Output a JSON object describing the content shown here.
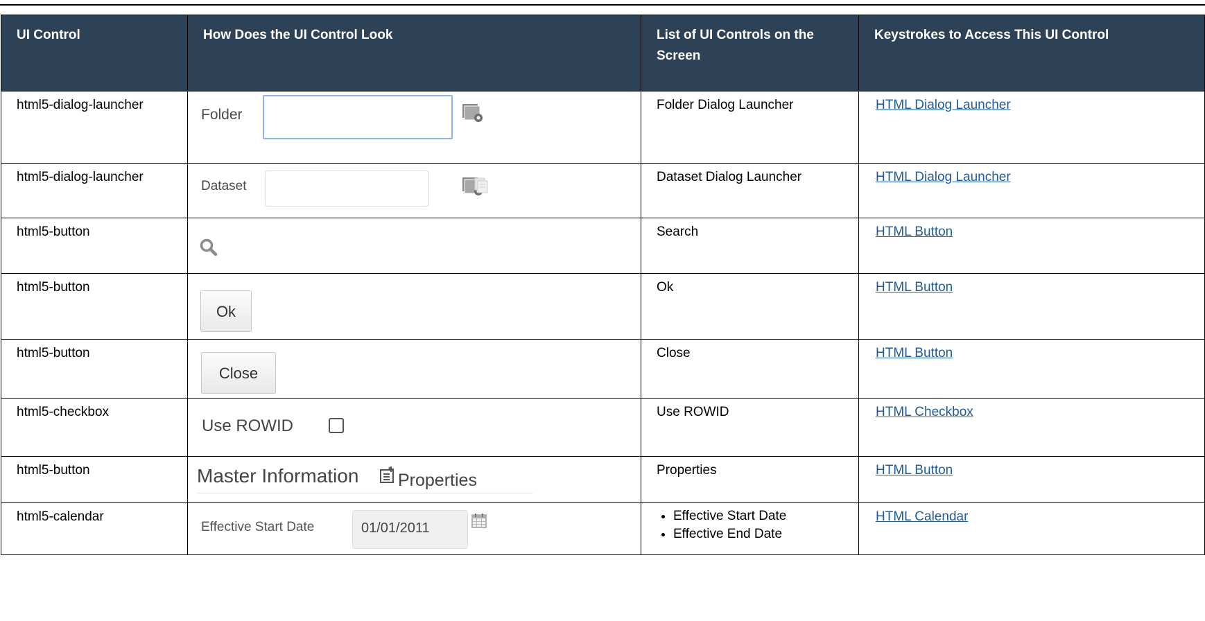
{
  "table": {
    "headers": {
      "ui_control": "UI Control",
      "look": "How Does the UI Control Look",
      "list": "List of UI Controls on the Screen",
      "keys": "Keystrokes to Access This UI Control"
    },
    "rows": [
      {
        "ui_control": "html5-dialog-launcher",
        "list": "Folder Dialog Launcher",
        "link": "HTML Dialog Launcher",
        "look": {
          "label": "Folder",
          "icon": "folder-dialog-icon"
        }
      },
      {
        "ui_control": "html5-dialog-launcher",
        "list": "Dataset Dialog Launcher",
        "link": "HTML Dialog Launcher",
        "look": {
          "label": "Dataset",
          "icons": [
            "folder-dialog-icon",
            "copy-icon"
          ]
        }
      },
      {
        "ui_control": "html5-button",
        "list": "Search",
        "link": "HTML Button",
        "look": {
          "icon": "search-icon"
        }
      },
      {
        "ui_control": "html5-button",
        "list": "Ok",
        "link": "HTML Button",
        "look": {
          "button_label": "Ok"
        }
      },
      {
        "ui_control": "html5-button",
        "list": "Close",
        "link": "HTML Button",
        "look": {
          "button_label": "Close"
        }
      },
      {
        "ui_control": "html5-checkbox",
        "list": "Use ROWID",
        "link": "HTML Checkbox",
        "look": {
          "label": "Use ROWID",
          "checked": false
        }
      },
      {
        "ui_control": "html5-button",
        "list": "Properties",
        "link": "HTML Button",
        "look": {
          "title": "Master Information",
          "button_label": "Properties",
          "icon": "edit-properties-icon"
        }
      },
      {
        "ui_control": "html5-calendar",
        "list_items": [
          "Effective Start Date",
          "Effective End Date"
        ],
        "link": "HTML Calendar",
        "look": {
          "label": "Effective Start Date",
          "value": "01/01/2011",
          "icon": "calendar-icon"
        }
      }
    ]
  },
  "colors": {
    "header_bg": "#2e4257",
    "header_text": "#ffffff",
    "link": "#1f5c99",
    "focus_border": "#8ab4f0"
  }
}
